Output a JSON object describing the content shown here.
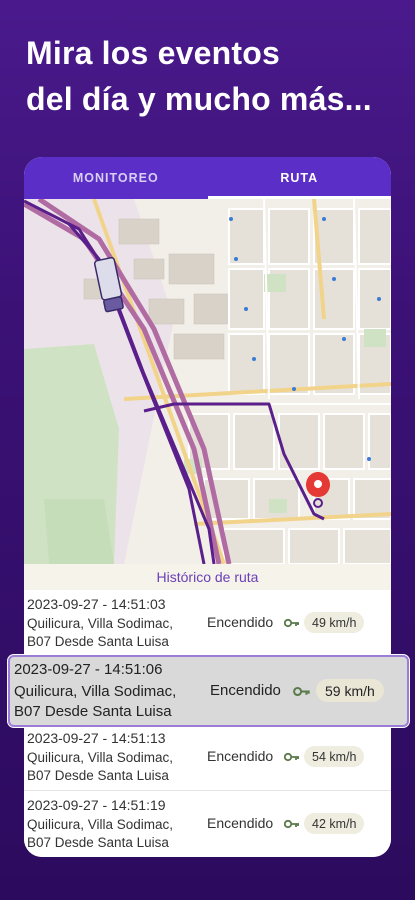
{
  "headline": {
    "line1": "Mira los eventos",
    "line2": "del día y mucho más..."
  },
  "tabs": [
    {
      "label": "MONITOREO",
      "active": false
    },
    {
      "label": "RUTA",
      "active": true
    }
  ],
  "history_title": "Histórico de ruta",
  "events": [
    {
      "datetime": "2023-09-27 - 14:51:03",
      "address_line1": "Quilicura, Villa Sodimac,",
      "address_line2": "B07 Desde Santa Luisa",
      "status": "Encendido",
      "speed": "49 km/h"
    },
    {
      "datetime": "2023-09-27 - 14:51:06",
      "address_line1": "Quilicura, Villa Sodimac,",
      "address_line2": "B07 Desde Santa Luisa",
      "status": "Encendido",
      "speed": "59 km/h",
      "selected": true
    },
    {
      "datetime": "2023-09-27 - 14:51:13",
      "address_line1": "Quilicura, Villa Sodimac,",
      "address_line2": "B07 Desde Santa Luisa",
      "status": "Encendido",
      "speed": "54 km/h"
    },
    {
      "datetime": "2023-09-27 - 14:51:19",
      "address_line1": "Quilicura, Villa Sodimac,",
      "address_line2": "B07 Desde Santa Luisa",
      "status": "Encendido",
      "speed": "42 km/h"
    }
  ],
  "colors": {
    "background": "#3b1176",
    "tab_bar": "#5b2ec7",
    "route": "#5a1f8a",
    "pin": "#e53935",
    "key_icon": "#5a7a4a"
  },
  "icons": [
    "truck-icon",
    "location-pin-icon",
    "key-icon"
  ]
}
